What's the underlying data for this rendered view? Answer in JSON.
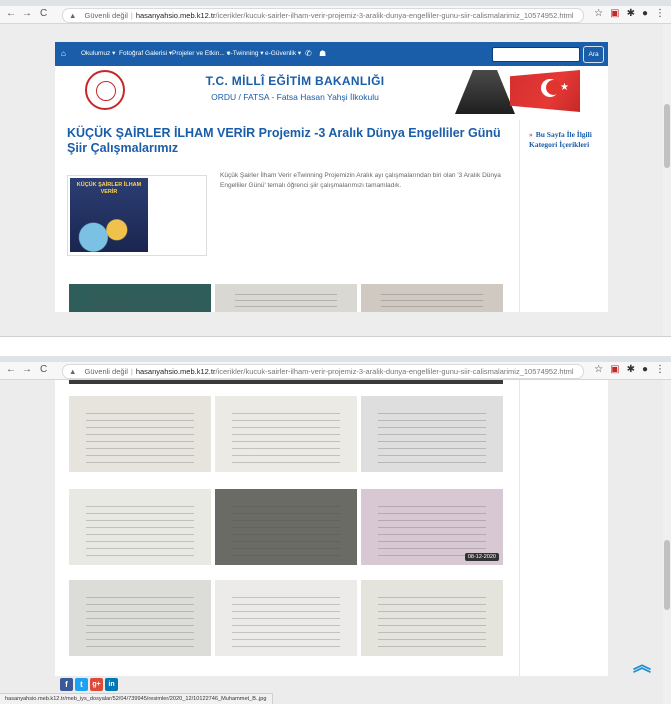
{
  "browser": {
    "security_label": "Güvenli değil",
    "url_host": "hasanyahsio.meb.k12.tr",
    "url_path_1": "/icerikler/kucuk-sairler-ilham-verir-projemiz-3-aralik-dunya-engelliler-gunu-siir-calismalarimiz_10574952.html",
    "url_path_2": "/icerikler/kucuk-sairler-ilham-verir-projemiz-3-aralik-dunya-engelliler-gunu-siir-calismalarimiz_10574952.html",
    "back_glyph": "←",
    "forward_glyph": "→",
    "reload_glyph": "C",
    "star_glyph": "☆",
    "ext_glyph": "▣",
    "puzzle_glyph": "✱",
    "profile_glyph": "●",
    "menu_glyph": "⋮",
    "lock_glyph": "▲",
    "url_sep": "|",
    "status_url": "hasanyahsio.meb.k12.tr/meb_iys_dosyalar/52/04/739945/resimler/2020_12/10122746_Muhammet_B..jpg"
  },
  "nav": {
    "home_glyph": "⌂",
    "items": [
      "Okulumuz",
      "Fotoğraf Galerisi",
      "Projeler ve Etkin...",
      "e-Twinning",
      "e-Güvenlik"
    ],
    "phone_glyph": "✆",
    "sitemap_glyph": "☗",
    "dropdown_glyph": "▾",
    "search_button": "Ara",
    "search_value": ""
  },
  "header": {
    "ministry": "T.C. MİLLÎ EĞİTİM BAKANLIĞI",
    "school": "ORDU / FATSA - Fatsa Hasan Yahşi İlkokulu",
    "flag_star": "★"
  },
  "article": {
    "title": "KÜÇÜK ŞAİRLER İLHAM VERİR Projemiz -3 Aralık Dünya Engelliler Günü Şiir Çalışmalarımız",
    "thumb_caption": "KÜÇÜK ŞAİRLER İLHAM VERİR",
    "intro": "Küçük Şairler İlham Verir eTwinning Projemizin Aralık ayı çalışmalarından biri olan '3 Aralık Dünya Engelliler Günü' temalı öğrenci şiir çalışmalarımızı tamamladık."
  },
  "sidebar": {
    "chevron": "»",
    "title": "Bu Sayfa İle İlgili Kategori İçerikleri"
  },
  "gallery": {
    "date_badge": "08-12-2020",
    "top_row_colors": [
      "#2f5d5a",
      "#d9d8d2",
      "#cfc9c2"
    ],
    "rows": [
      [
        "#e7e3dd",
        "#eceae4",
        "#dedede"
      ],
      [
        "#e9e9e3",
        "#6b6b66",
        "#d8c8d4"
      ],
      [
        "#dcdcd8",
        "#ecebea",
        "#e4e3dc"
      ]
    ]
  },
  "social": {
    "facebook": "f",
    "twitter": "t",
    "googleplus": "g+",
    "linkedin": "in",
    "to_top_glyph": "︽"
  }
}
